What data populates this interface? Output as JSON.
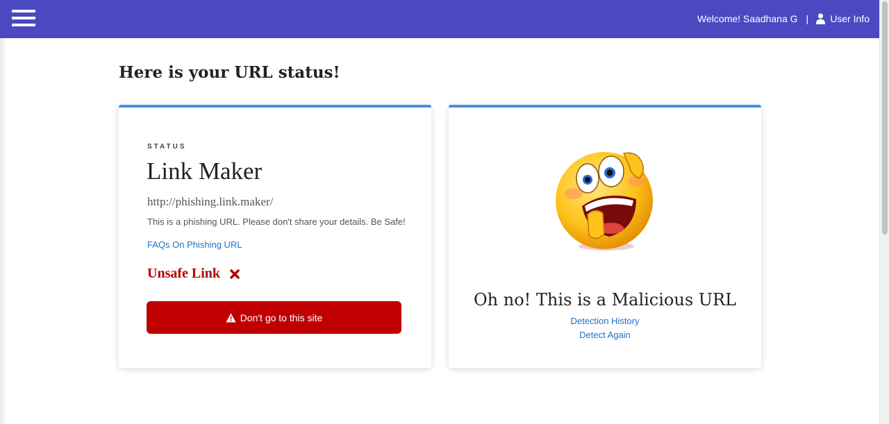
{
  "navbar": {
    "welcome_text": "Welcome! Saadhana G",
    "separator": "|",
    "user_info_label": "User Info",
    "background_color": "#4a49c2"
  },
  "page": {
    "heading": "Here is your URL status!"
  },
  "status_card": {
    "label": "STATUS",
    "site_name": "Link Maker",
    "url": "http://phishing.link.maker/",
    "description": "This is a phishing URL. Please don't share your details. Be Safe!",
    "faq_link": "FAQs On Phishing URL",
    "verdict": "Unsafe Link",
    "verdict_icon": "x-mark-icon",
    "verdict_color": "#b30000",
    "button_label": "Don't go to this site",
    "button_icon": "warning-icon",
    "button_color": "#c00000"
  },
  "result_card": {
    "emoji_icon": "shocked-emoji-icon",
    "title": "Oh no! This is a Malicious URL",
    "links": [
      "Detection History",
      "Detect Again"
    ]
  },
  "colors": {
    "card_accent": "#4a90e2",
    "link": "#1a73c8"
  }
}
